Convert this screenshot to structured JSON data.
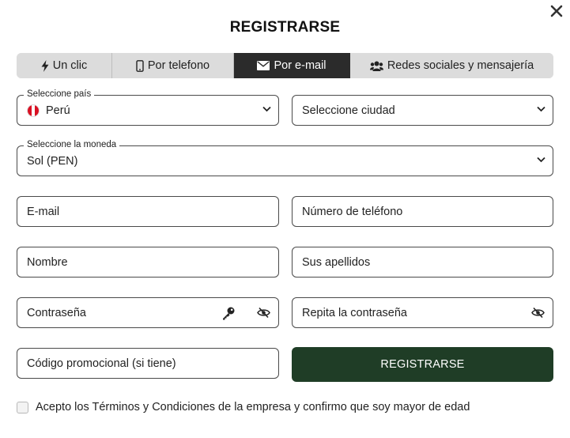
{
  "modal": {
    "title": "REGISTRARSE",
    "close_icon": "close-icon"
  },
  "tabs": [
    {
      "label": "Un clic",
      "icon": "lightning-icon",
      "active": false
    },
    {
      "label": "Por telefono",
      "icon": "phone-icon",
      "active": false
    },
    {
      "label": "Por e-mail",
      "icon": "envelope-icon",
      "active": true
    },
    {
      "label": "Redes sociales y mensajería",
      "icon": "users-icon",
      "active": false
    }
  ],
  "form": {
    "country": {
      "label": "Seleccione país",
      "value": "Perú"
    },
    "city": {
      "value": "Seleccione ciudad"
    },
    "currency": {
      "label": "Seleccione la moneda",
      "value": "Sol (PEN)"
    },
    "email": {
      "placeholder": "E-mail"
    },
    "phone": {
      "placeholder": "Número de teléfono"
    },
    "first_name": {
      "placeholder": "Nombre"
    },
    "last_name": {
      "placeholder": "Sus apellidos"
    },
    "password": {
      "placeholder": "Contraseña"
    },
    "password_repeat": {
      "placeholder": "Repita la contraseña"
    },
    "promo": {
      "placeholder": "Código promocional (si tiene)"
    },
    "submit_label": "REGISTRARSE",
    "terms_label": "Acepto los Términos y Condiciones de la empresa y confirmo que soy mayor de edad"
  },
  "colors": {
    "accent": "#1f3d26",
    "tab_active": "#2b2b2b",
    "tab_inactive": "#dcdcdc",
    "flag_red": "#d91023"
  }
}
